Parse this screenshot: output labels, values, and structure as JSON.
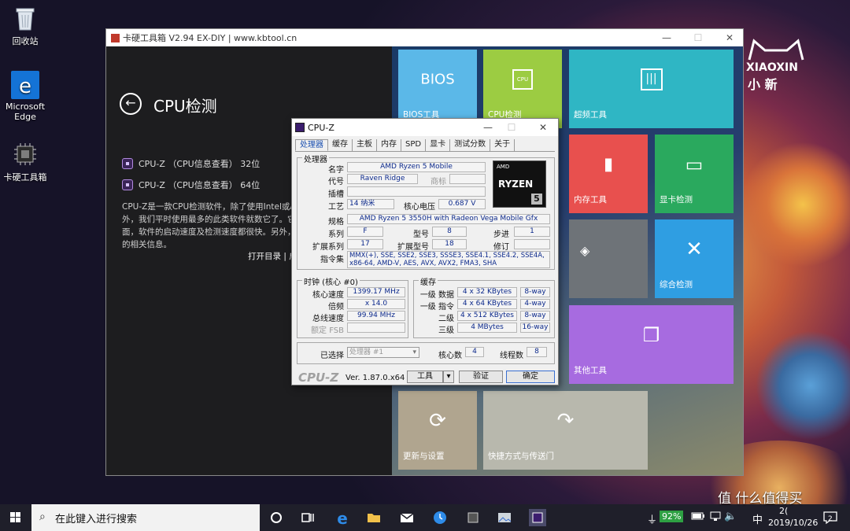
{
  "desktop": {
    "icons": [
      {
        "label": "回收站"
      },
      {
        "label": "Microsoft\nEdge"
      },
      {
        "label": "卡硬工具箱"
      }
    ],
    "brand": {
      "line1": "XIAOXIN",
      "line2": "小  新"
    }
  },
  "app": {
    "title": "卡硬工具箱 V2.94  EX-DIY  |  www.kbtool.cn",
    "controls": {
      "min": "—",
      "max": "☐",
      "close": "✕"
    },
    "left": {
      "page_title": "CPU检测",
      "items": [
        {
          "label": "CPU-Z （CPU信息查看） 32位"
        },
        {
          "label": "CPU-Z （CPU信息查看） 64位"
        }
      ],
      "description": "CPU-Z是一款CPU检测软件，除了使用Intel或AM外，我们平时使用最多的此类软件就数它了。它面，软件的启动速度及检测速度都很快。另外，的相关信息。",
      "links": "打开目录 | 启"
    },
    "tiles": [
      {
        "label": "BIOS工具",
        "glyph": "BIOS",
        "color": "#5bb8e8"
      },
      {
        "label": "CPU检测",
        "glyph": "CPU",
        "color": "#9ccc42"
      },
      {
        "label": "超频工具",
        "glyph": "|||",
        "color": "#2fb6c4"
      },
      {
        "label": "内存工具",
        "glyph": "▮",
        "color": "#e8504e"
      },
      {
        "label": "显卡检测",
        "glyph": "▭",
        "color": "#2aa95e"
      },
      {
        "label": "",
        "glyph": "◈",
        "color": "#6e7378"
      },
      {
        "label": "综合检测",
        "glyph": "✕",
        "color": "#2f9ee2"
      },
      {
        "label": "其他工具",
        "glyph": "❐",
        "color": "#a76be0"
      },
      {
        "label": "更新与设置",
        "glyph": "⟳",
        "color": "#b0a58f"
      },
      {
        "label": "快捷方式与传送门",
        "glyph": "↷",
        "color": "#b8b8ad"
      }
    ]
  },
  "cpuz": {
    "title": "CPU-Z",
    "controls": {
      "min": "—",
      "max": "☐",
      "close": "✕"
    },
    "tabs": [
      "处理器",
      "缓存",
      "主板",
      "内存",
      "SPD",
      "显卡",
      "测试分数",
      "关于"
    ],
    "processor": {
      "group_title": "处理器",
      "name_label": "名字",
      "name": "AMD Ryzen 5 Mobile",
      "codename_label": "代号",
      "codename": "Raven Ridge",
      "brand_label": "商标",
      "package_label": "插槽",
      "tech_label": "工艺",
      "tech": "14 纳米",
      "voltage_label": "核心电压",
      "voltage": "0.687 V",
      "spec_label": "规格",
      "spec": "AMD Ryzen 5 3550H with Radeon Vega Mobile Gfx",
      "family_label": "系列",
      "family": "F",
      "model_label": "型号",
      "model": "8",
      "stepping_label": "步进",
      "stepping": "1",
      "ext_family_label": "扩展系列",
      "ext_family": "17",
      "ext_model_label": "扩展型号",
      "ext_model": "18",
      "revision_label": "修订",
      "instr_label": "指令集",
      "instr": "MMX(+), SSE, SSE2, SSE3, SSSE3, SSE4.1, SSE4.2, SSE4A, x86-64, AMD-V, AES, AVX, AVX2, FMA3, SHA",
      "logo_brand": "AMD",
      "logo_text": "RYZEN",
      "logo_num": "5"
    },
    "clocks": {
      "group_title": "时钟 (核心 #0)",
      "core_speed_label": "核心速度",
      "core_speed": "1399.17 MHz",
      "multiplier_label": "倍频",
      "multiplier": "x 14.0",
      "bus_label": "总线速度",
      "bus": "99.94 MHz",
      "fsb_label": "额定 FSB"
    },
    "cache": {
      "group_title": "缓存",
      "l1d_label": "一级 数据",
      "l1d": "4 x 32 KBytes",
      "l1d_way": "8-way",
      "l1i_label": "一级 指令",
      "l1i": "4 x 64 KBytes",
      "l1i_way": "4-way",
      "l2_label": "二级",
      "l2": "4 x 512 KBytes",
      "l2_way": "8-way",
      "l3_label": "三级",
      "l3": "4 MBytes",
      "l3_way": "16-way"
    },
    "selection": {
      "selected_label": "已选择",
      "selected": "处理器 #1",
      "cores_label": "核心数",
      "cores": "4",
      "threads_label": "线程数",
      "threads": "8"
    },
    "footer": {
      "logo": "CPU-Z",
      "version": "Ver. 1.87.0.x64",
      "tools": "工具",
      "validate": "验证",
      "ok": "确定"
    }
  },
  "taskbar": {
    "search_placeholder": "在此键入进行搜索",
    "battery": "92%",
    "ime": "中",
    "time": "2(",
    "date": "2019/10/26",
    "notif_count": "2",
    "watermark": "值 什么值得买"
  }
}
